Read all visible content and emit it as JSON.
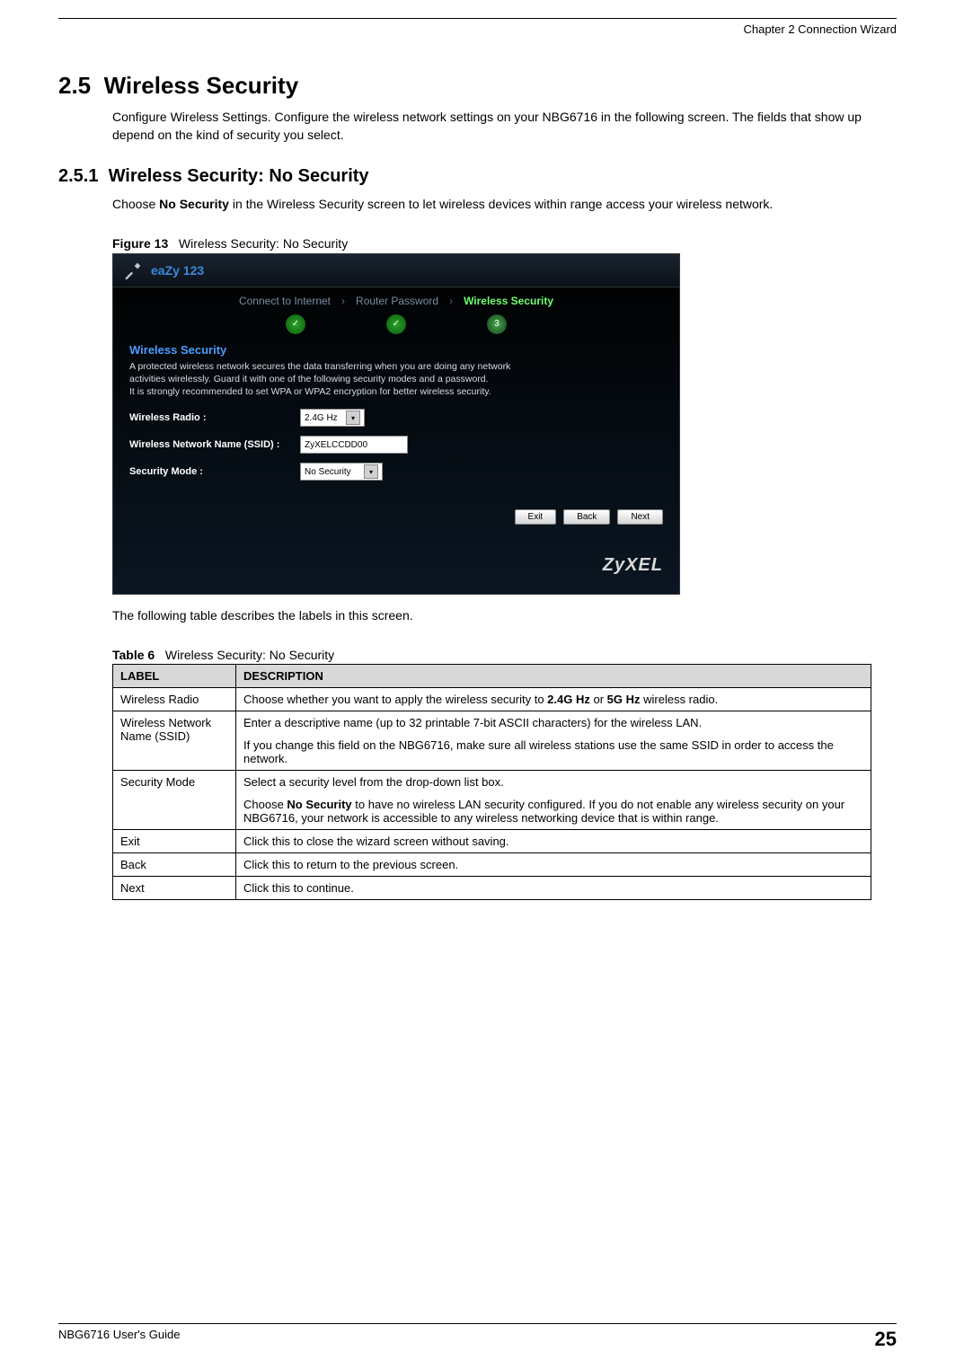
{
  "header": {
    "chapter": "Chapter 2 Connection Wizard"
  },
  "section": {
    "number": "2.5",
    "title": "Wireless Security",
    "intro": "Configure Wireless Settings. Configure the wireless network settings on your NBG6716 in the following screen. The fields that show up depend on the kind of security you select."
  },
  "subsection": {
    "number": "2.5.1",
    "title": "Wireless Security: No Security",
    "intro_pre": "Choose ",
    "intro_bold": "No Security",
    "intro_post": " in the Wireless Security screen to let wireless devices within range access your wireless network."
  },
  "figure": {
    "label": "Figure 13",
    "caption": "Wireless Security: No Security"
  },
  "screenshot": {
    "brand": "eaZy 123",
    "steps": {
      "step1": "Connect to Internet",
      "step2": "Router Password",
      "step3": "Wireless Security",
      "active_num": "3"
    },
    "panel_title": "Wireless Security",
    "panel_desc": "A protected wireless network secures the data transferring when you are doing any network activities wirelessly. Guard it with one of the following security modes and a password.\nIt is strongly recommended to set WPA or WPA2 encryption for better wireless security.",
    "fields": {
      "radio_label": "Wireless Radio :",
      "radio_value": "2.4G Hz",
      "ssid_label": "Wireless Network Name (SSID) :",
      "ssid_value": "ZyXELCCDD00",
      "mode_label": "Security Mode :",
      "mode_value": "No Security"
    },
    "buttons": {
      "exit": "Exit",
      "back": "Back",
      "next": "Next"
    },
    "logo": "ZyXEL"
  },
  "table_intro": "The following table describes the labels in this screen.",
  "table": {
    "label": "Table 6",
    "caption": "Wireless Security: No Security",
    "headers": {
      "c1": "LABEL",
      "c2": "DESCRIPTION"
    },
    "rows": [
      {
        "label": "Wireless Radio",
        "desc_parts": [
          {
            "t": "Choose whether you want to apply the wireless security to "
          },
          {
            "t": "2.4G Hz",
            "b": true
          },
          {
            "t": " or "
          },
          {
            "t": "5G Hz",
            "b": true
          },
          {
            "t": " wireless radio."
          }
        ]
      },
      {
        "label": "Wireless Network Name (SSID)",
        "desc_paras": [
          "Enter a descriptive name (up to 32 printable 7-bit ASCII characters) for the wireless LAN.",
          "If you change this field on the NBG6716, make sure all wireless stations use the same SSID in order to access the network."
        ]
      },
      {
        "label": "Security Mode",
        "desc_paras_rich": [
          [
            {
              "t": "Select a security level from the drop-down list box."
            }
          ],
          [
            {
              "t": "Choose "
            },
            {
              "t": "No Security",
              "b": true
            },
            {
              "t": " to have no wireless LAN security configured. If you do not enable any wireless security on your NBG6716, your network is accessible to any wireless networking device that is within range."
            }
          ]
        ]
      },
      {
        "label": "Exit",
        "desc": "Click this to close the wizard screen without saving."
      },
      {
        "label": "Back",
        "desc": "Click this to return to the previous screen."
      },
      {
        "label": "Next",
        "desc": "Click this to continue."
      }
    ]
  },
  "footer": {
    "guide": "NBG6716 User's Guide",
    "page": "25"
  }
}
